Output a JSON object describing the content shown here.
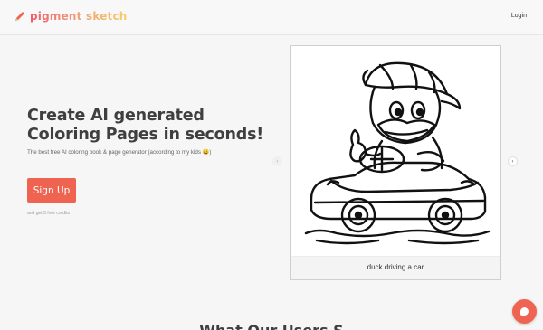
{
  "header": {
    "brand": "pigment sketch",
    "login_label": "Login"
  },
  "hero": {
    "title": "Create AI generated Coloring Pages in seconds!",
    "subtitle": "The best free AI coloring book & page generator (according to my kids 😄)",
    "signup_label": "Sign Up",
    "signup_note": "and get 5 free credits"
  },
  "carousel": {
    "prev_icon": "‹",
    "next_icon": "›",
    "caption": "duck driving a car"
  },
  "section_heading": "What Our Users S"
}
